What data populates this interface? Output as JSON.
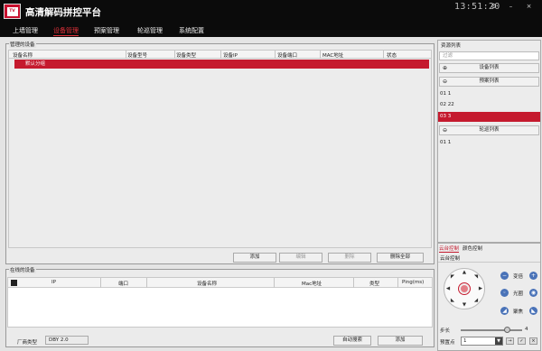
{
  "app": {
    "logo_text": "TV",
    "title": "高清解码拼控平台",
    "clock": "13:51:20"
  },
  "window": {
    "settings_icon": "gear",
    "minimize": "–",
    "close": "×"
  },
  "nav": {
    "tabs": [
      "上墙管理",
      "设备管理",
      "预案管理",
      "轮巡管理",
      "系统配置"
    ],
    "active": 1
  },
  "managed": {
    "title": "管理的设备",
    "columns": [
      "设备名称",
      "设备型号",
      "设备类型",
      "设备IP",
      "设备端口",
      "MAC地址",
      "状态"
    ],
    "group_row": "默认分组",
    "buttons": {
      "add": "添加",
      "edit": "编辑",
      "delete": "删除",
      "delete_all": "删除全部"
    }
  },
  "online": {
    "title": "在线的设备",
    "columns": [
      "IP",
      "端口",
      "设备名称",
      "Mac地址",
      "类型",
      "Ping(ms)"
    ],
    "vendor_label": "厂商类型",
    "vendor_value": "DBY 2.0",
    "auto_search": "自动搜索",
    "add": "添加"
  },
  "resources": {
    "title": "资源列表",
    "search_placeholder": "过滤",
    "device_list": {
      "mark": "⊕",
      "label": "设备列表"
    },
    "plan_list": {
      "mark": "⊖",
      "label": "预案列表"
    },
    "plan_items": [
      "01 1",
      "02 22",
      "03 3"
    ],
    "selected_plan_index": 2,
    "tour_list": {
      "mark": "⊖",
      "label": "轮巡列表"
    },
    "tour_items": [
      "01 1"
    ]
  },
  "ptz": {
    "tabs": [
      "云台控制",
      "颜色控制"
    ],
    "active_tab": 0,
    "section": "云台控制",
    "focus": "变倍",
    "iris": "光圈",
    "zoom": "聚焦",
    "step_label": "步长",
    "step_value": "4",
    "step_level": 0.75,
    "preset_label": "预置点",
    "preset_value": "1"
  }
}
